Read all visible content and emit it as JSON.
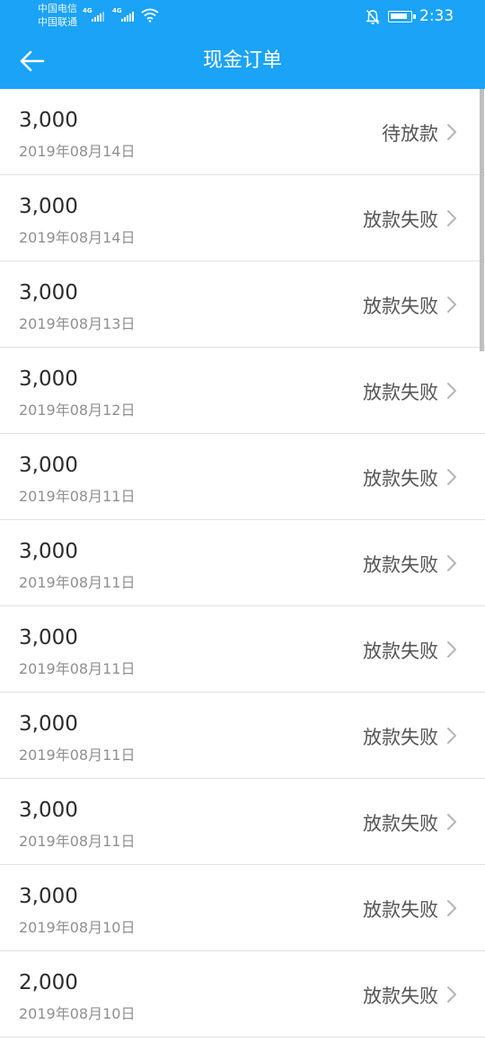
{
  "status_bar": {
    "carrier_1": "中国电信",
    "carrier_2": "中国联通",
    "network_1": "4G",
    "network_2": "4G",
    "time": "2:33"
  },
  "app_bar": {
    "title": "现金订单",
    "back_icon": "arrow-left-icon"
  },
  "orders": [
    {
      "amount": "3,000",
      "date": "2019年08月14日",
      "status": "待放款"
    },
    {
      "amount": "3,000",
      "date": "2019年08月14日",
      "status": "放款失败"
    },
    {
      "amount": "3,000",
      "date": "2019年08月13日",
      "status": "放款失败"
    },
    {
      "amount": "3,000",
      "date": "2019年08月12日",
      "status": "放款失败"
    },
    {
      "amount": "3,000",
      "date": "2019年08月11日",
      "status": "放款失败"
    },
    {
      "amount": "3,000",
      "date": "2019年08月11日",
      "status": "放款失败"
    },
    {
      "amount": "3,000",
      "date": "2019年08月11日",
      "status": "放款失败"
    },
    {
      "amount": "3,000",
      "date": "2019年08月11日",
      "status": "放款失败"
    },
    {
      "amount": "3,000",
      "date": "2019年08月11日",
      "status": "放款失败"
    },
    {
      "amount": "3,000",
      "date": "2019年08月10日",
      "status": "放款失败"
    },
    {
      "amount": "2,000",
      "date": "2019年08月10日",
      "status": "放款失败"
    }
  ],
  "colors": {
    "primary": "#1aa3f7",
    "divider": "#e2e2e2",
    "amount_text": "#2b2b2b",
    "date_text": "#8f8f8f",
    "status_text": "#555555"
  }
}
